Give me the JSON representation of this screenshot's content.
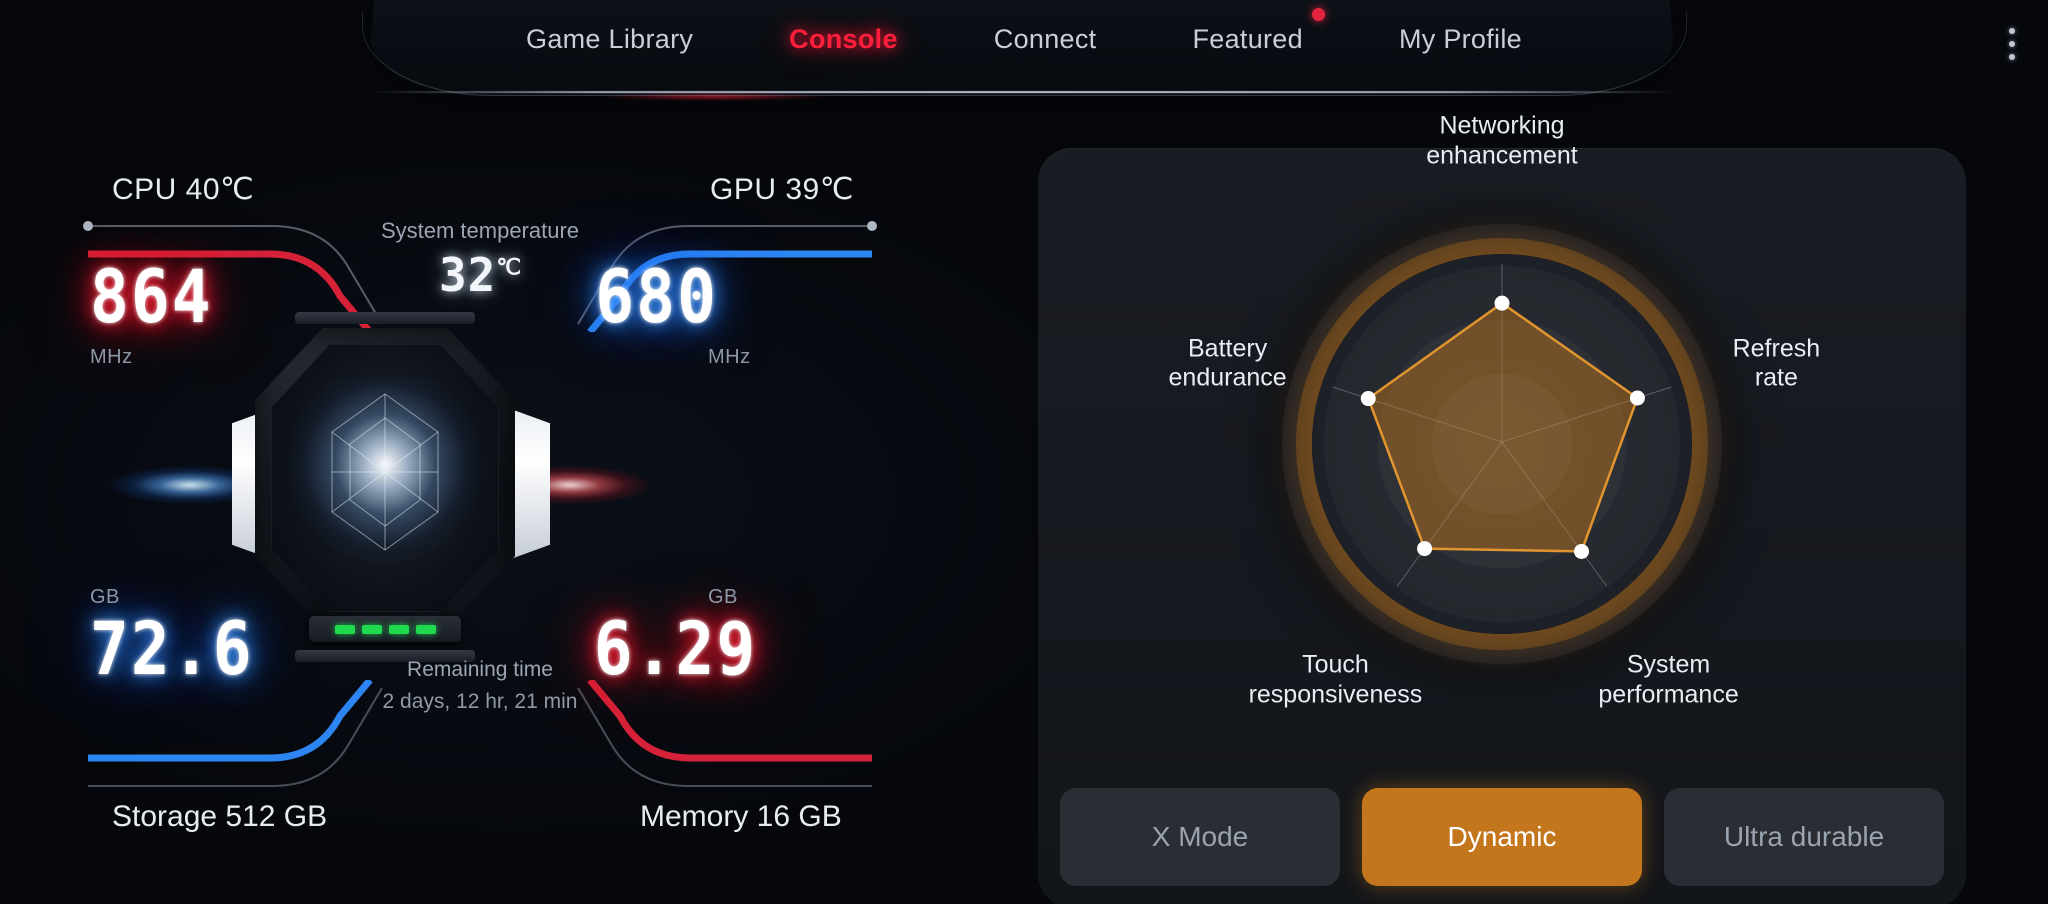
{
  "nav": {
    "items": [
      {
        "label": "Game Library",
        "active": false,
        "badge": false
      },
      {
        "label": "Console",
        "active": true,
        "badge": false
      },
      {
        "label": "Connect",
        "active": false,
        "badge": false
      },
      {
        "label": "Featured",
        "active": false,
        "badge": true
      },
      {
        "label": "My Profile",
        "active": false,
        "badge": false
      }
    ],
    "overflow_icon": "kebab-menu-icon"
  },
  "monitor": {
    "cpu_header": "CPU  40℃",
    "gpu_header": "GPU  39℃",
    "system_temp_label": "System temperature",
    "system_temp_value": "32",
    "system_temp_unit": "℃",
    "cpu_freq": "864",
    "cpu_freq_unit": "MHz",
    "gpu_freq": "680",
    "gpu_freq_unit": "MHz",
    "storage_free": "72.6",
    "storage_unit": "GB",
    "memory_free": "6.29",
    "memory_unit": "GB",
    "remaining_label": "Remaining time",
    "remaining_value": "2 days, 12 hr, 21 min",
    "storage_footer": "Storage  512 GB",
    "memory_footer": "Memory  16 GB",
    "accent_red": "#e2243c",
    "accent_blue": "#2f8cff"
  },
  "chart_data": {
    "type": "radar",
    "title": "",
    "categories": [
      "Networking\nenhancement",
      "Refresh rate",
      "System\nperformance",
      "Touch\nresponsiveness",
      "Battery\nendurance"
    ],
    "series": [
      {
        "name": "Dynamic",
        "values": [
          0.78,
          0.8,
          0.76,
          0.74,
          0.79
        ]
      }
    ],
    "max": 1.0,
    "rings": 3,
    "grid": true,
    "legend": "none",
    "fill_color": "#c3761b",
    "stroke_color": "#e0952f",
    "point_color": "#ffffff"
  },
  "modes": {
    "options": [
      {
        "label": "X Mode",
        "active": false
      },
      {
        "label": "Dynamic",
        "active": true
      },
      {
        "label": "Ultra durable",
        "active": false
      }
    ]
  }
}
